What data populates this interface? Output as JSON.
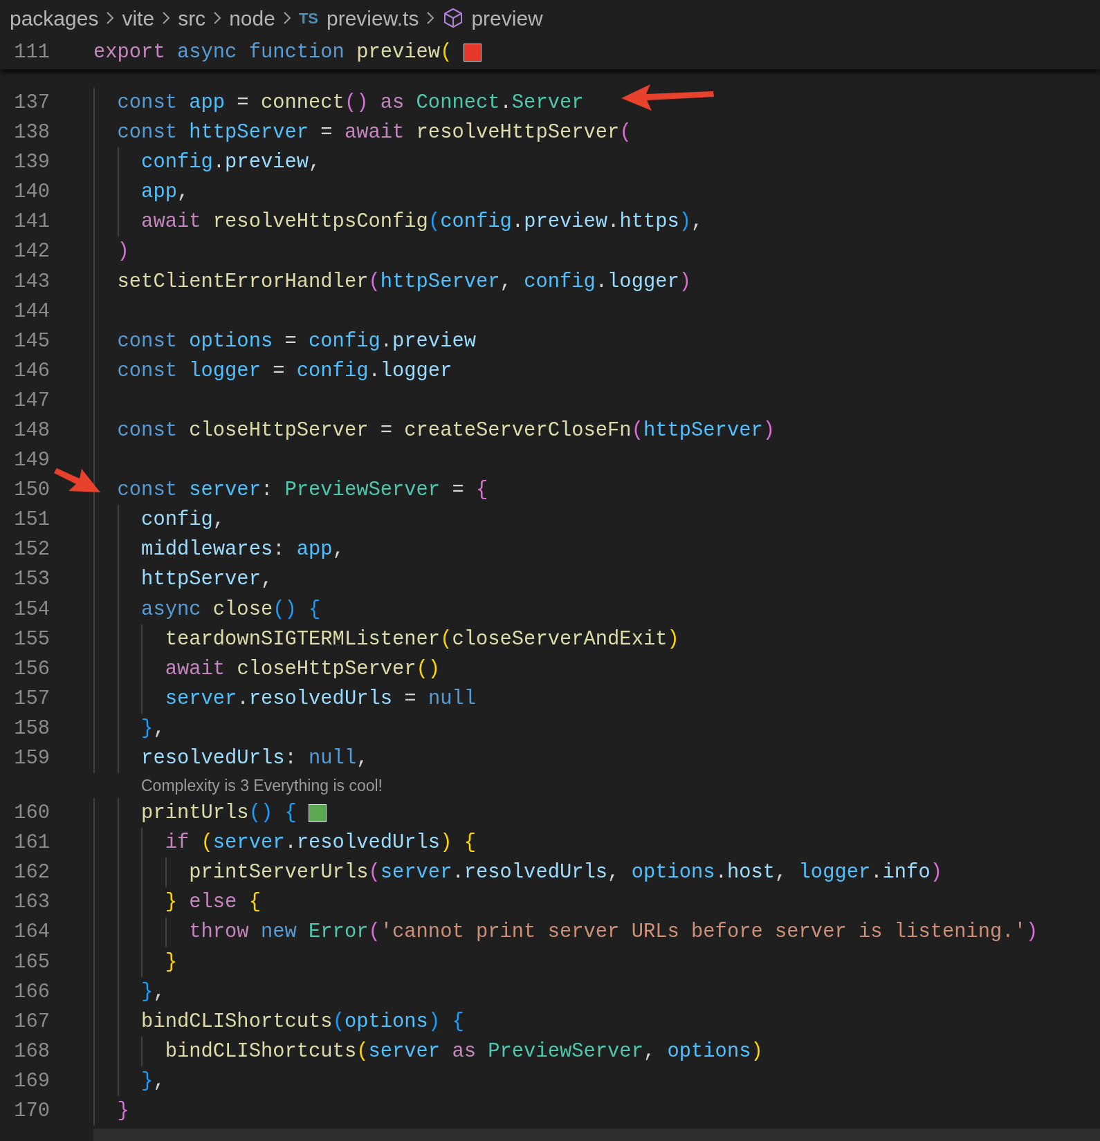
{
  "breadcrumbs": [
    {
      "kind": "folder",
      "label": "packages"
    },
    {
      "kind": "folder",
      "label": "vite"
    },
    {
      "kind": "folder",
      "label": "src"
    },
    {
      "kind": "folder",
      "label": "node"
    },
    {
      "kind": "file",
      "icon_text": "TS",
      "label": "preview.ts"
    },
    {
      "kind": "symbol",
      "label": "preview"
    }
  ],
  "sticky_line": {
    "number": "111",
    "tokens": [
      {
        "kind": "ctl",
        "text": "export "
      },
      {
        "kind": "kw",
        "text": "async "
      },
      {
        "kind": "kw",
        "text": "function "
      },
      {
        "kind": "fn",
        "text": "preview"
      },
      {
        "kind": "b1",
        "text": "("
      }
    ],
    "swatch": {
      "color": "#e8372b"
    }
  },
  "lines": [
    {
      "kind": "code",
      "number": "137",
      "tokens": [
        {
          "kind": "kw",
          "text": "  const "
        },
        {
          "kind": "const",
          "text": "app"
        },
        {
          "kind": "punc",
          "text": " = "
        },
        {
          "kind": "fn",
          "text": "connect"
        },
        {
          "kind": "b2",
          "text": "() "
        },
        {
          "kind": "ctl",
          "text": "as "
        },
        {
          "kind": "type",
          "text": "Connect"
        },
        {
          "kind": "punc",
          "text": "."
        },
        {
          "kind": "type",
          "text": "Server"
        }
      ]
    },
    {
      "kind": "code",
      "number": "138",
      "tokens": [
        {
          "kind": "kw",
          "text": "  const "
        },
        {
          "kind": "const",
          "text": "httpServer"
        },
        {
          "kind": "punc",
          "text": " = "
        },
        {
          "kind": "ctl",
          "text": "await "
        },
        {
          "kind": "fn",
          "text": "resolveHttpServer"
        },
        {
          "kind": "b2",
          "text": "("
        }
      ]
    },
    {
      "kind": "code",
      "number": "139",
      "tokens": [
        {
          "kind": "const",
          "text": "    config"
        },
        {
          "kind": "punc",
          "text": "."
        },
        {
          "kind": "var",
          "text": "preview"
        },
        {
          "kind": "punc",
          "text": ","
        }
      ]
    },
    {
      "kind": "code",
      "number": "140",
      "tokens": [
        {
          "kind": "const",
          "text": "    app"
        },
        {
          "kind": "punc",
          "text": ","
        }
      ]
    },
    {
      "kind": "code",
      "number": "141",
      "tokens": [
        {
          "kind": "ctl",
          "text": "    await "
        },
        {
          "kind": "fn",
          "text": "resolveHttpsConfig"
        },
        {
          "kind": "b3",
          "text": "("
        },
        {
          "kind": "const",
          "text": "config"
        },
        {
          "kind": "punc",
          "text": "."
        },
        {
          "kind": "var",
          "text": "preview"
        },
        {
          "kind": "punc",
          "text": "."
        },
        {
          "kind": "var",
          "text": "https"
        },
        {
          "kind": "b3",
          "text": ")"
        },
        {
          "kind": "punc",
          "text": ","
        }
      ]
    },
    {
      "kind": "code",
      "number": "142",
      "tokens": [
        {
          "kind": "b2",
          "text": "  )"
        }
      ]
    },
    {
      "kind": "code",
      "number": "143",
      "tokens": [
        {
          "kind": "fn",
          "text": "  setClientErrorHandler"
        },
        {
          "kind": "b2",
          "text": "("
        },
        {
          "kind": "const",
          "text": "httpServer"
        },
        {
          "kind": "punc",
          "text": ", "
        },
        {
          "kind": "const",
          "text": "config"
        },
        {
          "kind": "punc",
          "text": "."
        },
        {
          "kind": "var",
          "text": "logger"
        },
        {
          "kind": "b2",
          "text": ")"
        }
      ]
    },
    {
      "kind": "code",
      "number": "144"
    },
    {
      "kind": "code",
      "number": "145",
      "tokens": [
        {
          "kind": "kw",
          "text": "  const "
        },
        {
          "kind": "const",
          "text": "options"
        },
        {
          "kind": "punc",
          "text": " = "
        },
        {
          "kind": "const",
          "text": "config"
        },
        {
          "kind": "punc",
          "text": "."
        },
        {
          "kind": "var",
          "text": "preview"
        }
      ]
    },
    {
      "kind": "code",
      "number": "146",
      "tokens": [
        {
          "kind": "kw",
          "text": "  const "
        },
        {
          "kind": "const",
          "text": "logger"
        },
        {
          "kind": "punc",
          "text": " = "
        },
        {
          "kind": "const",
          "text": "config"
        },
        {
          "kind": "punc",
          "text": "."
        },
        {
          "kind": "var",
          "text": "logger"
        }
      ]
    },
    {
      "kind": "code",
      "number": "147"
    },
    {
      "kind": "code",
      "number": "148",
      "tokens": [
        {
          "kind": "kw",
          "text": "  const "
        },
        {
          "kind": "fn",
          "text": "closeHttpServer"
        },
        {
          "kind": "punc",
          "text": " = "
        },
        {
          "kind": "fn",
          "text": "createServerCloseFn"
        },
        {
          "kind": "b2",
          "text": "("
        },
        {
          "kind": "const",
          "text": "httpServer"
        },
        {
          "kind": "b2",
          "text": ")"
        }
      ]
    },
    {
      "kind": "code",
      "number": "149"
    },
    {
      "kind": "code",
      "number": "150",
      "tokens": [
        {
          "kind": "kw",
          "text": "  const "
        },
        {
          "kind": "const",
          "text": "server"
        },
        {
          "kind": "punc",
          "text": ": "
        },
        {
          "kind": "type",
          "text": "PreviewServer"
        },
        {
          "kind": "punc",
          "text": " = "
        },
        {
          "kind": "b2",
          "text": "{"
        }
      ]
    },
    {
      "kind": "code",
      "number": "151",
      "tokens": [
        {
          "kind": "var",
          "text": "    config"
        },
        {
          "kind": "punc",
          "text": ","
        }
      ]
    },
    {
      "kind": "code",
      "number": "152",
      "tokens": [
        {
          "kind": "var",
          "text": "    middlewares"
        },
        {
          "kind": "punc",
          "text": ": "
        },
        {
          "kind": "const",
          "text": "app"
        },
        {
          "kind": "punc",
          "text": ","
        }
      ]
    },
    {
      "kind": "code",
      "number": "153",
      "tokens": [
        {
          "kind": "var",
          "text": "    httpServer"
        },
        {
          "kind": "punc",
          "text": ","
        }
      ]
    },
    {
      "kind": "code",
      "number": "154",
      "tokens": [
        {
          "kind": "kw",
          "text": "    async "
        },
        {
          "kind": "fn",
          "text": "close"
        },
        {
          "kind": "b3",
          "text": "() {"
        }
      ]
    },
    {
      "kind": "code",
      "number": "155",
      "tokens": [
        {
          "kind": "fn",
          "text": "      teardownSIGTERMListener"
        },
        {
          "kind": "b1",
          "text": "("
        },
        {
          "kind": "fn",
          "text": "closeServerAndExit"
        },
        {
          "kind": "b1",
          "text": ")"
        }
      ]
    },
    {
      "kind": "code",
      "number": "156",
      "tokens": [
        {
          "kind": "ctl",
          "text": "      await "
        },
        {
          "kind": "fn",
          "text": "closeHttpServer"
        },
        {
          "kind": "b1",
          "text": "()"
        }
      ]
    },
    {
      "kind": "code",
      "number": "157",
      "tokens": [
        {
          "kind": "const",
          "text": "      server"
        },
        {
          "kind": "punc",
          "text": "."
        },
        {
          "kind": "var",
          "text": "resolvedUrls"
        },
        {
          "kind": "punc",
          "text": " = "
        },
        {
          "kind": "kw",
          "text": "null"
        }
      ]
    },
    {
      "kind": "code",
      "number": "158",
      "tokens": [
        {
          "kind": "b3",
          "text": "    }"
        },
        {
          "kind": "punc",
          "text": ","
        }
      ]
    },
    {
      "kind": "code",
      "number": "159",
      "tokens": [
        {
          "kind": "var",
          "text": "    resolvedUrls"
        },
        {
          "kind": "punc",
          "text": ": "
        },
        {
          "kind": "kw",
          "text": "null"
        },
        {
          "kind": "punc",
          "text": ","
        }
      ]
    },
    {
      "kind": "codelens",
      "text": "Complexity is 3 Everything is cool!"
    },
    {
      "kind": "code",
      "number": "160",
      "tokens": [
        {
          "kind": "fn",
          "text": "    printUrls"
        },
        {
          "kind": "b3",
          "text": "() {"
        }
      ],
      "swatch": {
        "color": "#5aa851"
      }
    },
    {
      "kind": "code",
      "number": "161",
      "tokens": [
        {
          "kind": "ctl",
          "text": "      if "
        },
        {
          "kind": "b1",
          "text": "("
        },
        {
          "kind": "const",
          "text": "server"
        },
        {
          "kind": "punc",
          "text": "."
        },
        {
          "kind": "var",
          "text": "resolvedUrls"
        },
        {
          "kind": "b1",
          "text": ") {"
        }
      ]
    },
    {
      "kind": "code",
      "number": "162",
      "tokens": [
        {
          "kind": "fn",
          "text": "        printServerUrls"
        },
        {
          "kind": "b2",
          "text": "("
        },
        {
          "kind": "const",
          "text": "server"
        },
        {
          "kind": "punc",
          "text": "."
        },
        {
          "kind": "var",
          "text": "resolvedUrls"
        },
        {
          "kind": "punc",
          "text": ", "
        },
        {
          "kind": "const",
          "text": "options"
        },
        {
          "kind": "punc",
          "text": "."
        },
        {
          "kind": "var",
          "text": "host"
        },
        {
          "kind": "punc",
          "text": ", "
        },
        {
          "kind": "const",
          "text": "logger"
        },
        {
          "kind": "punc",
          "text": "."
        },
        {
          "kind": "var",
          "text": "info"
        },
        {
          "kind": "b2",
          "text": ")"
        }
      ]
    },
    {
      "kind": "code",
      "number": "163",
      "tokens": [
        {
          "kind": "b1",
          "text": "      } "
        },
        {
          "kind": "ctl",
          "text": "else "
        },
        {
          "kind": "b1",
          "text": "{"
        }
      ]
    },
    {
      "kind": "code",
      "number": "164",
      "tokens": [
        {
          "kind": "ctl",
          "text": "        throw "
        },
        {
          "kind": "kw",
          "text": "new "
        },
        {
          "kind": "type",
          "text": "Error"
        },
        {
          "kind": "b2",
          "text": "("
        },
        {
          "kind": "str",
          "text": "'cannot print server URLs before server is listening.'"
        },
        {
          "kind": "b2",
          "text": ")"
        }
      ]
    },
    {
      "kind": "code",
      "number": "165",
      "tokens": [
        {
          "kind": "b1",
          "text": "      }"
        }
      ]
    },
    {
      "kind": "code",
      "number": "166",
      "tokens": [
        {
          "kind": "b3",
          "text": "    }"
        },
        {
          "kind": "punc",
          "text": ","
        }
      ]
    },
    {
      "kind": "code",
      "number": "167",
      "tokens": [
        {
          "kind": "fn",
          "text": "    bindCLIShortcuts"
        },
        {
          "kind": "b3",
          "text": "("
        },
        {
          "kind": "const",
          "text": "options"
        },
        {
          "kind": "b3",
          "text": ") {"
        }
      ]
    },
    {
      "kind": "code",
      "number": "168",
      "tokens": [
        {
          "kind": "fn",
          "text": "      bindCLIShortcuts"
        },
        {
          "kind": "b1",
          "text": "("
        },
        {
          "kind": "const",
          "text": "server "
        },
        {
          "kind": "ctl",
          "text": "as "
        },
        {
          "kind": "type",
          "text": "PreviewServer"
        },
        {
          "kind": "punc",
          "text": ", "
        },
        {
          "kind": "const",
          "text": "options"
        },
        {
          "kind": "b1",
          "text": ")"
        }
      ]
    },
    {
      "kind": "code",
      "number": "169",
      "tokens": [
        {
          "kind": "b3",
          "text": "    }"
        },
        {
          "kind": "punc",
          "text": ","
        }
      ]
    },
    {
      "kind": "code",
      "number": "170",
      "tokens": [
        {
          "kind": "b2",
          "text": "  }"
        }
      ]
    }
  ]
}
